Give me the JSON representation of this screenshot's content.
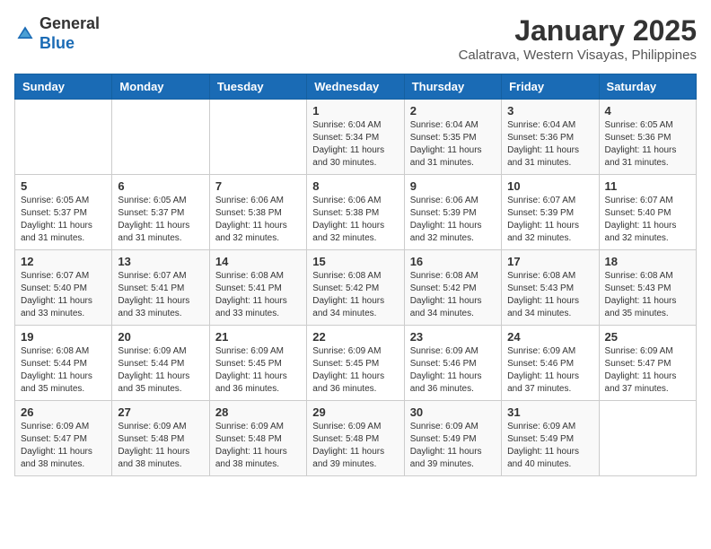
{
  "header": {
    "logo_general": "General",
    "logo_blue": "Blue",
    "month": "January 2025",
    "location": "Calatrava, Western Visayas, Philippines"
  },
  "days_of_week": [
    "Sunday",
    "Monday",
    "Tuesday",
    "Wednesday",
    "Thursday",
    "Friday",
    "Saturday"
  ],
  "weeks": [
    [
      {
        "day": "",
        "info": ""
      },
      {
        "day": "",
        "info": ""
      },
      {
        "day": "",
        "info": ""
      },
      {
        "day": "1",
        "info": "Sunrise: 6:04 AM\nSunset: 5:34 PM\nDaylight: 11 hours\nand 30 minutes."
      },
      {
        "day": "2",
        "info": "Sunrise: 6:04 AM\nSunset: 5:35 PM\nDaylight: 11 hours\nand 31 minutes."
      },
      {
        "day": "3",
        "info": "Sunrise: 6:04 AM\nSunset: 5:36 PM\nDaylight: 11 hours\nand 31 minutes."
      },
      {
        "day": "4",
        "info": "Sunrise: 6:05 AM\nSunset: 5:36 PM\nDaylight: 11 hours\nand 31 minutes."
      }
    ],
    [
      {
        "day": "5",
        "info": "Sunrise: 6:05 AM\nSunset: 5:37 PM\nDaylight: 11 hours\nand 31 minutes."
      },
      {
        "day": "6",
        "info": "Sunrise: 6:05 AM\nSunset: 5:37 PM\nDaylight: 11 hours\nand 31 minutes."
      },
      {
        "day": "7",
        "info": "Sunrise: 6:06 AM\nSunset: 5:38 PM\nDaylight: 11 hours\nand 32 minutes."
      },
      {
        "day": "8",
        "info": "Sunrise: 6:06 AM\nSunset: 5:38 PM\nDaylight: 11 hours\nand 32 minutes."
      },
      {
        "day": "9",
        "info": "Sunrise: 6:06 AM\nSunset: 5:39 PM\nDaylight: 11 hours\nand 32 minutes."
      },
      {
        "day": "10",
        "info": "Sunrise: 6:07 AM\nSunset: 5:39 PM\nDaylight: 11 hours\nand 32 minutes."
      },
      {
        "day": "11",
        "info": "Sunrise: 6:07 AM\nSunset: 5:40 PM\nDaylight: 11 hours\nand 32 minutes."
      }
    ],
    [
      {
        "day": "12",
        "info": "Sunrise: 6:07 AM\nSunset: 5:40 PM\nDaylight: 11 hours\nand 33 minutes."
      },
      {
        "day": "13",
        "info": "Sunrise: 6:07 AM\nSunset: 5:41 PM\nDaylight: 11 hours\nand 33 minutes."
      },
      {
        "day": "14",
        "info": "Sunrise: 6:08 AM\nSunset: 5:41 PM\nDaylight: 11 hours\nand 33 minutes."
      },
      {
        "day": "15",
        "info": "Sunrise: 6:08 AM\nSunset: 5:42 PM\nDaylight: 11 hours\nand 34 minutes."
      },
      {
        "day": "16",
        "info": "Sunrise: 6:08 AM\nSunset: 5:42 PM\nDaylight: 11 hours\nand 34 minutes."
      },
      {
        "day": "17",
        "info": "Sunrise: 6:08 AM\nSunset: 5:43 PM\nDaylight: 11 hours\nand 34 minutes."
      },
      {
        "day": "18",
        "info": "Sunrise: 6:08 AM\nSunset: 5:43 PM\nDaylight: 11 hours\nand 35 minutes."
      }
    ],
    [
      {
        "day": "19",
        "info": "Sunrise: 6:08 AM\nSunset: 5:44 PM\nDaylight: 11 hours\nand 35 minutes."
      },
      {
        "day": "20",
        "info": "Sunrise: 6:09 AM\nSunset: 5:44 PM\nDaylight: 11 hours\nand 35 minutes."
      },
      {
        "day": "21",
        "info": "Sunrise: 6:09 AM\nSunset: 5:45 PM\nDaylight: 11 hours\nand 36 minutes."
      },
      {
        "day": "22",
        "info": "Sunrise: 6:09 AM\nSunset: 5:45 PM\nDaylight: 11 hours\nand 36 minutes."
      },
      {
        "day": "23",
        "info": "Sunrise: 6:09 AM\nSunset: 5:46 PM\nDaylight: 11 hours\nand 36 minutes."
      },
      {
        "day": "24",
        "info": "Sunrise: 6:09 AM\nSunset: 5:46 PM\nDaylight: 11 hours\nand 37 minutes."
      },
      {
        "day": "25",
        "info": "Sunrise: 6:09 AM\nSunset: 5:47 PM\nDaylight: 11 hours\nand 37 minutes."
      }
    ],
    [
      {
        "day": "26",
        "info": "Sunrise: 6:09 AM\nSunset: 5:47 PM\nDaylight: 11 hours\nand 38 minutes."
      },
      {
        "day": "27",
        "info": "Sunrise: 6:09 AM\nSunset: 5:48 PM\nDaylight: 11 hours\nand 38 minutes."
      },
      {
        "day": "28",
        "info": "Sunrise: 6:09 AM\nSunset: 5:48 PM\nDaylight: 11 hours\nand 38 minutes."
      },
      {
        "day": "29",
        "info": "Sunrise: 6:09 AM\nSunset: 5:48 PM\nDaylight: 11 hours\nand 39 minutes."
      },
      {
        "day": "30",
        "info": "Sunrise: 6:09 AM\nSunset: 5:49 PM\nDaylight: 11 hours\nand 39 minutes."
      },
      {
        "day": "31",
        "info": "Sunrise: 6:09 AM\nSunset: 5:49 PM\nDaylight: 11 hours\nand 40 minutes."
      },
      {
        "day": "",
        "info": ""
      }
    ]
  ]
}
